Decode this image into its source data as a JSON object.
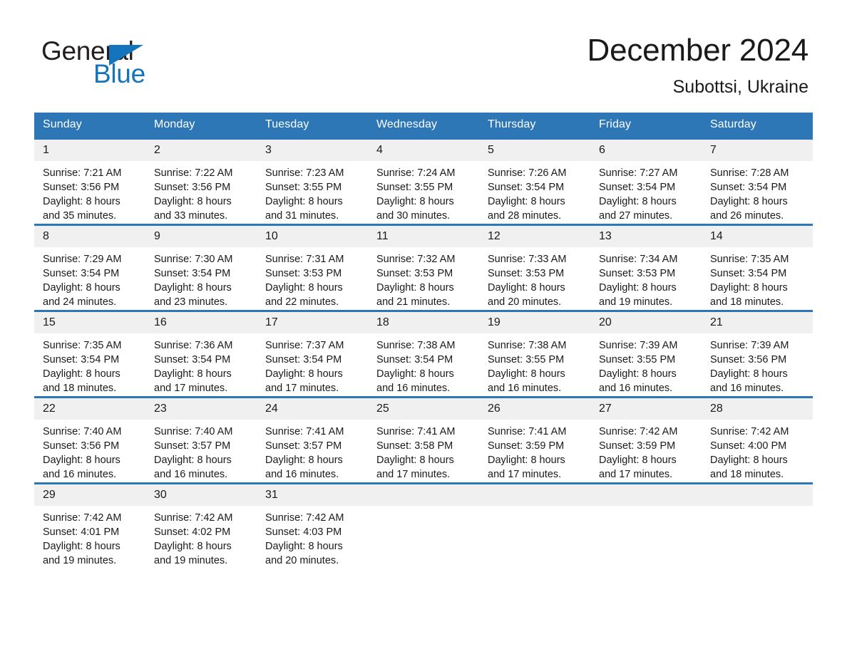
{
  "logo": {
    "word1": "General",
    "word2": "Blue",
    "triangle_color": "#1574bb",
    "text_color": "#231f20"
  },
  "header": {
    "title": "December 2024",
    "subtitle": "Subottsi, Ukraine"
  },
  "theme": {
    "header_bg": "#2e77b7",
    "header_text": "#ffffff",
    "daynum_bg": "#f0f0f0",
    "cell_bg": "#ffffff",
    "rule_color": "#2e77b7"
  },
  "weekdays": [
    "Sunday",
    "Monday",
    "Tuesday",
    "Wednesday",
    "Thursday",
    "Friday",
    "Saturday"
  ],
  "weeks": [
    [
      {
        "day": "1",
        "sunrise": "Sunrise: 7:21 AM",
        "sunset": "Sunset: 3:56 PM",
        "daylight1": "Daylight: 8 hours",
        "daylight2": "and 35 minutes."
      },
      {
        "day": "2",
        "sunrise": "Sunrise: 7:22 AM",
        "sunset": "Sunset: 3:56 PM",
        "daylight1": "Daylight: 8 hours",
        "daylight2": "and 33 minutes."
      },
      {
        "day": "3",
        "sunrise": "Sunrise: 7:23 AM",
        "sunset": "Sunset: 3:55 PM",
        "daylight1": "Daylight: 8 hours",
        "daylight2": "and 31 minutes."
      },
      {
        "day": "4",
        "sunrise": "Sunrise: 7:24 AM",
        "sunset": "Sunset: 3:55 PM",
        "daylight1": "Daylight: 8 hours",
        "daylight2": "and 30 minutes."
      },
      {
        "day": "5",
        "sunrise": "Sunrise: 7:26 AM",
        "sunset": "Sunset: 3:54 PM",
        "daylight1": "Daylight: 8 hours",
        "daylight2": "and 28 minutes."
      },
      {
        "day": "6",
        "sunrise": "Sunrise: 7:27 AM",
        "sunset": "Sunset: 3:54 PM",
        "daylight1": "Daylight: 8 hours",
        "daylight2": "and 27 minutes."
      },
      {
        "day": "7",
        "sunrise": "Sunrise: 7:28 AM",
        "sunset": "Sunset: 3:54 PM",
        "daylight1": "Daylight: 8 hours",
        "daylight2": "and 26 minutes."
      }
    ],
    [
      {
        "day": "8",
        "sunrise": "Sunrise: 7:29 AM",
        "sunset": "Sunset: 3:54 PM",
        "daylight1": "Daylight: 8 hours",
        "daylight2": "and 24 minutes."
      },
      {
        "day": "9",
        "sunrise": "Sunrise: 7:30 AM",
        "sunset": "Sunset: 3:54 PM",
        "daylight1": "Daylight: 8 hours",
        "daylight2": "and 23 minutes."
      },
      {
        "day": "10",
        "sunrise": "Sunrise: 7:31 AM",
        "sunset": "Sunset: 3:53 PM",
        "daylight1": "Daylight: 8 hours",
        "daylight2": "and 22 minutes."
      },
      {
        "day": "11",
        "sunrise": "Sunrise: 7:32 AM",
        "sunset": "Sunset: 3:53 PM",
        "daylight1": "Daylight: 8 hours",
        "daylight2": "and 21 minutes."
      },
      {
        "day": "12",
        "sunrise": "Sunrise: 7:33 AM",
        "sunset": "Sunset: 3:53 PM",
        "daylight1": "Daylight: 8 hours",
        "daylight2": "and 20 minutes."
      },
      {
        "day": "13",
        "sunrise": "Sunrise: 7:34 AM",
        "sunset": "Sunset: 3:53 PM",
        "daylight1": "Daylight: 8 hours",
        "daylight2": "and 19 minutes."
      },
      {
        "day": "14",
        "sunrise": "Sunrise: 7:35 AM",
        "sunset": "Sunset: 3:54 PM",
        "daylight1": "Daylight: 8 hours",
        "daylight2": "and 18 minutes."
      }
    ],
    [
      {
        "day": "15",
        "sunrise": "Sunrise: 7:35 AM",
        "sunset": "Sunset: 3:54 PM",
        "daylight1": "Daylight: 8 hours",
        "daylight2": "and 18 minutes."
      },
      {
        "day": "16",
        "sunrise": "Sunrise: 7:36 AM",
        "sunset": "Sunset: 3:54 PM",
        "daylight1": "Daylight: 8 hours",
        "daylight2": "and 17 minutes."
      },
      {
        "day": "17",
        "sunrise": "Sunrise: 7:37 AM",
        "sunset": "Sunset: 3:54 PM",
        "daylight1": "Daylight: 8 hours",
        "daylight2": "and 17 minutes."
      },
      {
        "day": "18",
        "sunrise": "Sunrise: 7:38 AM",
        "sunset": "Sunset: 3:54 PM",
        "daylight1": "Daylight: 8 hours",
        "daylight2": "and 16 minutes."
      },
      {
        "day": "19",
        "sunrise": "Sunrise: 7:38 AM",
        "sunset": "Sunset: 3:55 PM",
        "daylight1": "Daylight: 8 hours",
        "daylight2": "and 16 minutes."
      },
      {
        "day": "20",
        "sunrise": "Sunrise: 7:39 AM",
        "sunset": "Sunset: 3:55 PM",
        "daylight1": "Daylight: 8 hours",
        "daylight2": "and 16 minutes."
      },
      {
        "day": "21",
        "sunrise": "Sunrise: 7:39 AM",
        "sunset": "Sunset: 3:56 PM",
        "daylight1": "Daylight: 8 hours",
        "daylight2": "and 16 minutes."
      }
    ],
    [
      {
        "day": "22",
        "sunrise": "Sunrise: 7:40 AM",
        "sunset": "Sunset: 3:56 PM",
        "daylight1": "Daylight: 8 hours",
        "daylight2": "and 16 minutes."
      },
      {
        "day": "23",
        "sunrise": "Sunrise: 7:40 AM",
        "sunset": "Sunset: 3:57 PM",
        "daylight1": "Daylight: 8 hours",
        "daylight2": "and 16 minutes."
      },
      {
        "day": "24",
        "sunrise": "Sunrise: 7:41 AM",
        "sunset": "Sunset: 3:57 PM",
        "daylight1": "Daylight: 8 hours",
        "daylight2": "and 16 minutes."
      },
      {
        "day": "25",
        "sunrise": "Sunrise: 7:41 AM",
        "sunset": "Sunset: 3:58 PM",
        "daylight1": "Daylight: 8 hours",
        "daylight2": "and 17 minutes."
      },
      {
        "day": "26",
        "sunrise": "Sunrise: 7:41 AM",
        "sunset": "Sunset: 3:59 PM",
        "daylight1": "Daylight: 8 hours",
        "daylight2": "and 17 minutes."
      },
      {
        "day": "27",
        "sunrise": "Sunrise: 7:42 AM",
        "sunset": "Sunset: 3:59 PM",
        "daylight1": "Daylight: 8 hours",
        "daylight2": "and 17 minutes."
      },
      {
        "day": "28",
        "sunrise": "Sunrise: 7:42 AM",
        "sunset": "Sunset: 4:00 PM",
        "daylight1": "Daylight: 8 hours",
        "daylight2": "and 18 minutes."
      }
    ],
    [
      {
        "day": "29",
        "sunrise": "Sunrise: 7:42 AM",
        "sunset": "Sunset: 4:01 PM",
        "daylight1": "Daylight: 8 hours",
        "daylight2": "and 19 minutes."
      },
      {
        "day": "30",
        "sunrise": "Sunrise: 7:42 AM",
        "sunset": "Sunset: 4:02 PM",
        "daylight1": "Daylight: 8 hours",
        "daylight2": "and 19 minutes."
      },
      {
        "day": "31",
        "sunrise": "Sunrise: 7:42 AM",
        "sunset": "Sunset: 4:03 PM",
        "daylight1": "Daylight: 8 hours",
        "daylight2": "and 20 minutes."
      },
      {
        "day": "",
        "sunrise": "",
        "sunset": "",
        "daylight1": "",
        "daylight2": ""
      },
      {
        "day": "",
        "sunrise": "",
        "sunset": "",
        "daylight1": "",
        "daylight2": ""
      },
      {
        "day": "",
        "sunrise": "",
        "sunset": "",
        "daylight1": "",
        "daylight2": ""
      },
      {
        "day": "",
        "sunrise": "",
        "sunset": "",
        "daylight1": "",
        "daylight2": ""
      }
    ]
  ]
}
